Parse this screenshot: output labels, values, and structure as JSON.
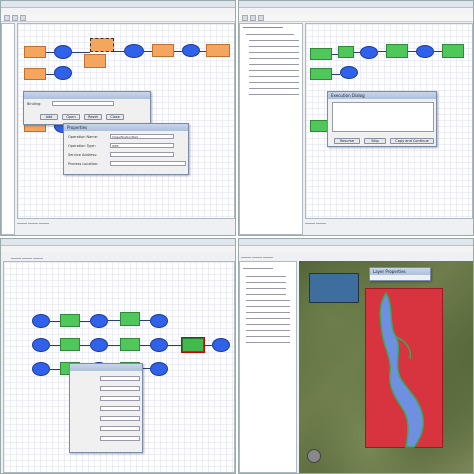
{
  "colors": {
    "orange_node": "#f4a65f",
    "green_node": "#4fc75a",
    "blue_node": "#2f62e8",
    "red_overlay": "#d8343f"
  },
  "q1": {
    "dialog_small": {
      "label": "Binding:",
      "buttons": [
        "Add",
        "Open",
        "Reset",
        "Close"
      ]
    },
    "dialog_props": {
      "title": "Properties",
      "rows": [
        {
          "label": "Operation Name:",
          "value": "ClassificationTest"
        },
        {
          "label": "Operation Type:",
          "value": "WPS"
        },
        {
          "label": "Service Address:",
          "value": ""
        },
        {
          "label": "Process Location:",
          "value": ""
        }
      ]
    }
  },
  "q2": {
    "dialog": {
      "title": "Execution Dialog",
      "buttons": [
        "Resume",
        "Skip",
        "Copy and Continue"
      ]
    }
  },
  "q4": {
    "popup_title": "Layer Properties"
  }
}
